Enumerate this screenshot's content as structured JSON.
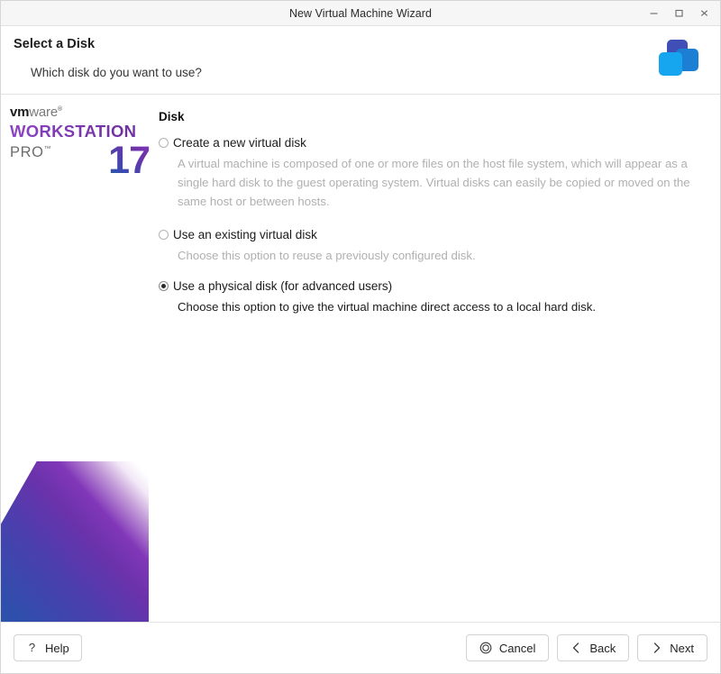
{
  "window": {
    "title": "New Virtual Machine Wizard",
    "controls": {
      "minimize": "minimize-icon",
      "maximize": "maximize-icon",
      "close": "close-icon"
    }
  },
  "header": {
    "title": "Select a Disk",
    "subtitle": "Which disk do you want to use?",
    "logo_icon": "vmware-cubes-icon",
    "colors": {
      "cube_back": "#3f4fb5",
      "cube_right": "#1d7fd4",
      "cube_front": "#16a6ef"
    }
  },
  "sidebar": {
    "brand_vm": "vm",
    "brand_ware": "ware",
    "brand_registered": "®",
    "product": "WORKSTATION",
    "edition": "PRO",
    "trademark": "™",
    "version": "17",
    "colors": {
      "product_purple": "#7b3fa9",
      "edition_gray": "#6d6d6d",
      "deco_purple": "#8137b8",
      "deco_blue": "#1f5fa8"
    }
  },
  "main": {
    "group_title": "Disk",
    "options": [
      {
        "label": "Create a new virtual disk",
        "description": "A virtual machine is composed of one or more files on the host file system, which will appear as a single hard disk to the guest operating system. Virtual disks can easily be copied or moved on the same host or between hosts.",
        "selected": false
      },
      {
        "label": "Use an existing virtual disk",
        "description": "Choose this option to reuse a previously configured disk.",
        "selected": false
      },
      {
        "label": "Use a physical disk (for advanced users)",
        "description": "Choose this option to give the virtual machine direct access to a local hard disk.",
        "selected": true
      }
    ]
  },
  "footer": {
    "help_label": "Help",
    "help_icon": "question-mark-icon",
    "cancel_label": "Cancel",
    "cancel_icon": "stop-circle-icon",
    "back_label": "Back",
    "back_icon": "chevron-left-icon",
    "next_label": "Next",
    "next_icon": "chevron-right-icon"
  }
}
